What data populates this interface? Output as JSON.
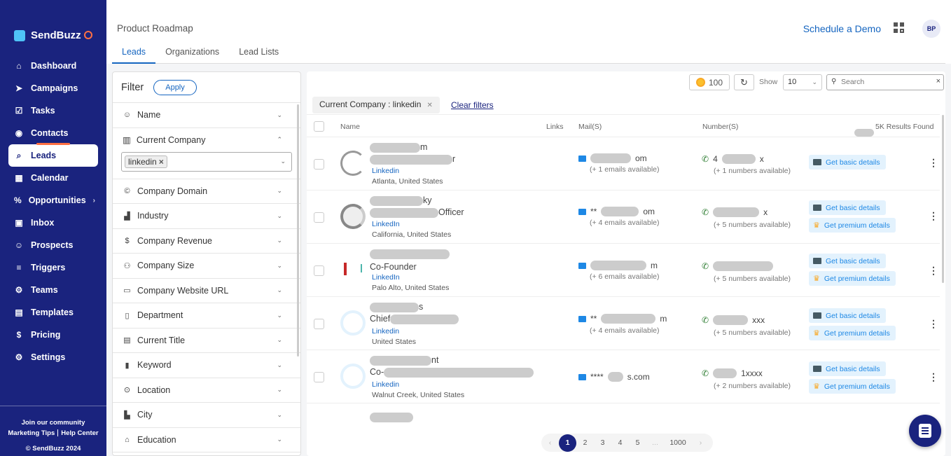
{
  "brand": {
    "name": "SendBuzz"
  },
  "sidebar": {
    "items": [
      {
        "label": "Dashboard",
        "icon": "home-icon"
      },
      {
        "label": "Campaigns",
        "icon": "send-icon"
      },
      {
        "label": "Tasks",
        "icon": "checkbox-icon"
      },
      {
        "label": "Contacts",
        "icon": "contact-icon"
      },
      {
        "label": "Leads",
        "icon": "leads-icon",
        "active": true
      },
      {
        "label": "Calendar",
        "icon": "calendar-icon"
      },
      {
        "label": "Opportunities",
        "icon": "percent-icon"
      },
      {
        "label": "Inbox",
        "icon": "inbox-icon"
      },
      {
        "label": "Prospects",
        "icon": "person-icon"
      },
      {
        "label": "Triggers",
        "icon": "triggers-icon"
      },
      {
        "label": "Teams",
        "icon": "gear-icon"
      },
      {
        "label": "Templates",
        "icon": "document-icon"
      },
      {
        "label": "Pricing",
        "icon": "dollar-icon"
      },
      {
        "label": "Settings",
        "icon": "gear-icon"
      }
    ],
    "footer": {
      "community": "Join our community",
      "marketing": "Marketing Tips",
      "help": "Help Center",
      "copyright": "© SendBuzz 2024"
    }
  },
  "header": {
    "title": "Product Roadmap",
    "demo": "Schedule a Demo",
    "avatar": "BP"
  },
  "tabs": [
    "Leads",
    "Organizations",
    "Lead Lists"
  ],
  "filter": {
    "title": "Filter",
    "apply": "Apply",
    "items_top": [
      "Name"
    ],
    "expanded": {
      "label": "Current Company",
      "chip": "linkedin"
    },
    "items": [
      "Company Domain",
      "Industry",
      "Company Revenue",
      "Company Size",
      "Company Website URL",
      "Department",
      "Current Title",
      "Keyword",
      "Location",
      "City",
      "Education"
    ]
  },
  "toolbar": {
    "credits": "100",
    "show_label": "Show",
    "show_value": "10",
    "search_placeholder": "Search"
  },
  "active_filter": {
    "label": "Current Company",
    "value": ": linkedin",
    "clear": "Clear filters"
  },
  "table": {
    "headers": [
      "Name",
      "Links",
      "Mail(S)",
      "Number(S)",
      "5K Results Found"
    ],
    "rows": [
      {
        "name_suffix": "m",
        "title_suffix": "r",
        "link": "Linkedin",
        "location": "Atlanta, United States",
        "mail_prefix": "",
        "mail_suffix": "om",
        "mail_avail": "(+ 1 emails available)",
        "phone_prefix": "4",
        "phone_suffix": "x",
        "phone_avail": "(+ 1 numbers available)",
        "basic": "Get basic details",
        "premium": ""
      },
      {
        "name_suffix": "ky",
        "title_suffix": "Officer",
        "link": "LinkedIn",
        "location": "California, United States",
        "mail_prefix": "**",
        "mail_suffix": "om",
        "mail_avail": "(+ 4 emails available)",
        "phone_prefix": "",
        "phone_suffix": "x",
        "phone_avail": "(+ 5 numbers available)",
        "basic": "Get basic details",
        "premium": "Get premium details"
      },
      {
        "name_suffix": "",
        "title_suffix": "Co-Founder",
        "link": "LinkedIn",
        "location": "Palo Alto, United States",
        "mail_prefix": "",
        "mail_suffix": "m",
        "mail_avail": "(+ 6 emails available)",
        "phone_prefix": "",
        "phone_suffix": "",
        "phone_avail": "(+ 5 numbers available)",
        "basic": "Get basic details",
        "premium": "Get premium details"
      },
      {
        "name_suffix": "s",
        "title_suffix": "Chief",
        "link": "Linkedin",
        "location": "United States",
        "mail_prefix": "**",
        "mail_suffix": "m",
        "mail_avail": "(+ 4 emails available)",
        "phone_prefix": "",
        "phone_suffix": "xxx",
        "phone_avail": "(+ 5 numbers available)",
        "basic": "Get basic details",
        "premium": "Get premium details"
      },
      {
        "name_suffix": "nt",
        "title_suffix": "Co-",
        "link": "Linkedin",
        "location": "Walnut Creek, United States",
        "mail_prefix": "****",
        "mail_suffix": "s.com",
        "mail_avail": "",
        "phone_prefix": "",
        "phone_suffix": "1xxxx",
        "phone_avail": "(+ 2 numbers available)",
        "basic": "Get basic details",
        "premium": "Get premium details"
      }
    ]
  },
  "pagination": {
    "pages": [
      "1",
      "2",
      "3",
      "4",
      "5",
      "...",
      "1000"
    ],
    "prev": "‹",
    "next": "›"
  },
  "colors": {
    "sidebar": "#1a237e",
    "accent": "#1565c0",
    "highlight": "#ff7043"
  }
}
